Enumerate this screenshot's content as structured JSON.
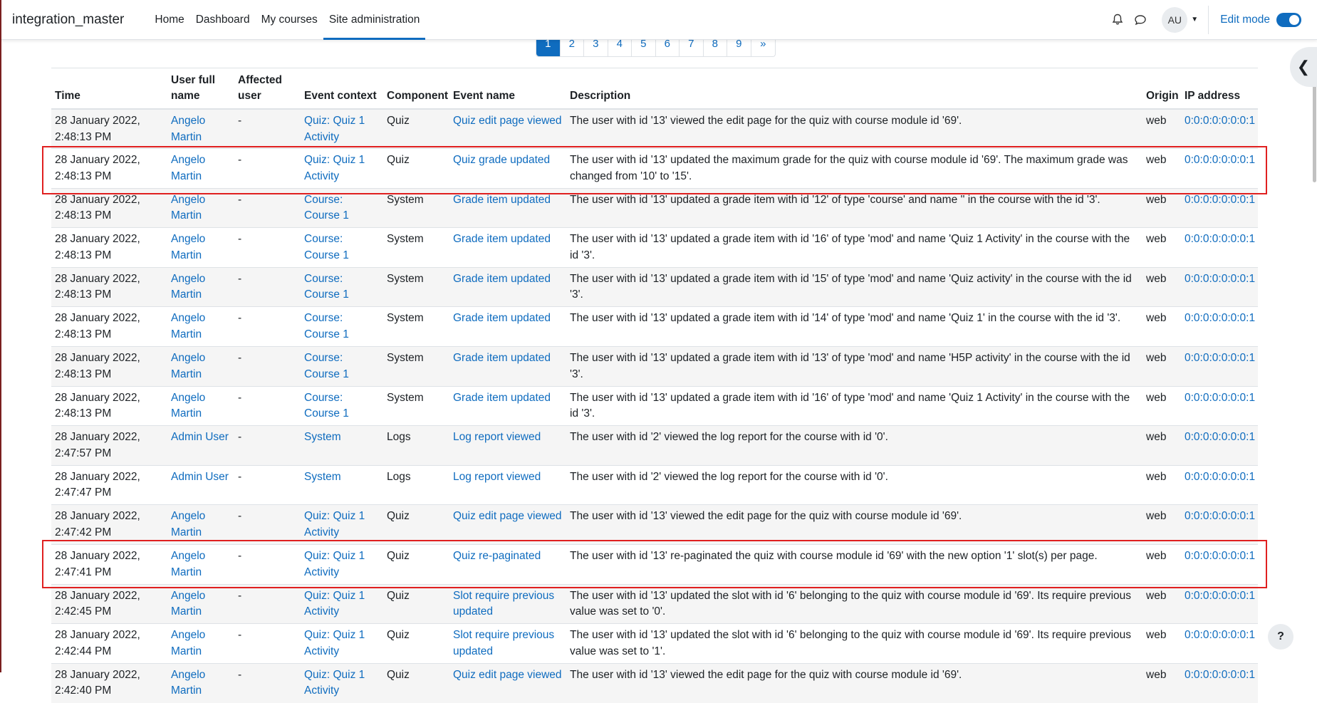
{
  "navbar": {
    "brand": "integration_master",
    "links": [
      "Home",
      "Dashboard",
      "My courses",
      "Site administration"
    ],
    "avatar": "AU",
    "edit_mode": "Edit mode"
  },
  "pagination": [
    "1",
    "2",
    "3",
    "4",
    "5",
    "6",
    "7",
    "8",
    "9",
    "»"
  ],
  "table": {
    "headers": [
      "Time",
      "User full name",
      "Affected user",
      "Event context",
      "Component",
      "Event name",
      "Description",
      "Origin",
      "IP address"
    ],
    "rows": [
      {
        "time": "28 January 2022, 2:48:13 PM",
        "user": "Angelo Martin",
        "affected": "-",
        "context": "Quiz: Quiz 1 Activity",
        "component": "Quiz",
        "event": "Quiz edit page viewed",
        "description": "The user with id '13' viewed the edit page for the quiz with course module id '69'.",
        "origin": "web",
        "ip": "0:0:0:0:0:0:0:1"
      },
      {
        "time": "28 January 2022, 2:48:13 PM",
        "user": "Angelo Martin",
        "affected": "-",
        "context": "Quiz: Quiz 1 Activity",
        "component": "Quiz",
        "event": "Quiz grade updated",
        "description": "The user with id '13' updated the maximum grade for the quiz with course module id '69'. The maximum grade was changed from '10' to '15'.",
        "origin": "web",
        "ip": "0:0:0:0:0:0:0:1"
      },
      {
        "time": "28 January 2022, 2:48:13 PM",
        "user": "Angelo Martin",
        "affected": "-",
        "context": "Course: Course 1",
        "component": "System",
        "event": "Grade item updated",
        "description": "The user with id '13' updated a grade item with id '12' of type 'course' and name '' in the course with the id '3'.",
        "origin": "web",
        "ip": "0:0:0:0:0:0:0:1"
      },
      {
        "time": "28 January 2022, 2:48:13 PM",
        "user": "Angelo Martin",
        "affected": "-",
        "context": "Course: Course 1",
        "component": "System",
        "event": "Grade item updated",
        "description": "The user with id '13' updated a grade item with id '16' of type 'mod' and name 'Quiz 1 Activity' in the course with the id '3'.",
        "origin": "web",
        "ip": "0:0:0:0:0:0:0:1"
      },
      {
        "time": "28 January 2022, 2:48:13 PM",
        "user": "Angelo Martin",
        "affected": "-",
        "context": "Course: Course 1",
        "component": "System",
        "event": "Grade item updated",
        "description": "The user with id '13' updated a grade item with id '15' of type 'mod' and name 'Quiz activity' in the course with the id '3'.",
        "origin": "web",
        "ip": "0:0:0:0:0:0:0:1"
      },
      {
        "time": "28 January 2022, 2:48:13 PM",
        "user": "Angelo Martin",
        "affected": "-",
        "context": "Course: Course 1",
        "component": "System",
        "event": "Grade item updated",
        "description": "The user with id '13' updated a grade item with id '14' of type 'mod' and name 'Quiz 1' in the course with the id '3'.",
        "origin": "web",
        "ip": "0:0:0:0:0:0:0:1"
      },
      {
        "time": "28 January 2022, 2:48:13 PM",
        "user": "Angelo Martin",
        "affected": "-",
        "context": "Course: Course 1",
        "component": "System",
        "event": "Grade item updated",
        "description": "The user with id '13' updated a grade item with id '13' of type 'mod' and name 'H5P activity' in the course with the id '3'.",
        "origin": "web",
        "ip": "0:0:0:0:0:0:0:1"
      },
      {
        "time": "28 January 2022, 2:48:13 PM",
        "user": "Angelo Martin",
        "affected": "-",
        "context": "Course: Course 1",
        "component": "System",
        "event": "Grade item updated",
        "description": "The user with id '13' updated a grade item with id '16' of type 'mod' and name 'Quiz 1 Activity' in the course with the id '3'.",
        "origin": "web",
        "ip": "0:0:0:0:0:0:0:1"
      },
      {
        "time": "28 January 2022, 2:47:57 PM",
        "user": "Admin User",
        "affected": "-",
        "context": "System",
        "component": "Logs",
        "event": "Log report viewed",
        "description": "The user with id '2' viewed the log report for the course with id '0'.",
        "origin": "web",
        "ip": "0:0:0:0:0:0:0:1"
      },
      {
        "time": "28 January 2022, 2:47:47 PM",
        "user": "Admin User",
        "affected": "-",
        "context": "System",
        "component": "Logs",
        "event": "Log report viewed",
        "description": "The user with id '2' viewed the log report for the course with id '0'.",
        "origin": "web",
        "ip": "0:0:0:0:0:0:0:1"
      },
      {
        "time": "28 January 2022, 2:47:42 PM",
        "user": "Angelo Martin",
        "affected": "-",
        "context": "Quiz: Quiz 1 Activity",
        "component": "Quiz",
        "event": "Quiz edit page viewed",
        "description": "The user with id '13' viewed the edit page for the quiz with course module id '69'.",
        "origin": "web",
        "ip": "0:0:0:0:0:0:0:1"
      },
      {
        "time": "28 January 2022, 2:47:41 PM",
        "user": "Angelo Martin",
        "affected": "-",
        "context": "Quiz: Quiz 1 Activity",
        "component": "Quiz",
        "event": "Quiz re-paginated",
        "description": "The user with id '13' re-paginated the quiz with course module id '69' with the new option '1' slot(s) per page.",
        "origin": "web",
        "ip": "0:0:0:0:0:0:0:1"
      },
      {
        "time": "28 January 2022, 2:42:45 PM",
        "user": "Angelo Martin",
        "affected": "-",
        "context": "Quiz: Quiz 1 Activity",
        "component": "Quiz",
        "event": "Slot require previous updated",
        "description": "The user with id '13' updated the slot with id '6' belonging to the quiz with course module id '69'. Its require previous value was set to '0'.",
        "origin": "web",
        "ip": "0:0:0:0:0:0:0:1"
      },
      {
        "time": "28 January 2022, 2:42:44 PM",
        "user": "Angelo Martin",
        "affected": "-",
        "context": "Quiz: Quiz 1 Activity",
        "component": "Quiz",
        "event": "Slot require previous updated",
        "description": "The user with id '13' updated the slot with id '6' belonging to the quiz with course module id '69'. Its require previous value was set to '1'.",
        "origin": "web",
        "ip": "0:0:0:0:0:0:0:1"
      },
      {
        "time": "28 January 2022, 2:42:40 PM",
        "user": "Angelo Martin",
        "affected": "-",
        "context": "Quiz: Quiz 1 Activity",
        "component": "Quiz",
        "event": "Quiz edit page viewed",
        "description": "The user with id '13' viewed the edit page for the quiz with course module id '69'.",
        "origin": "web",
        "ip": "0:0:0:0:0:0:0:1"
      }
    ]
  },
  "help": "?"
}
